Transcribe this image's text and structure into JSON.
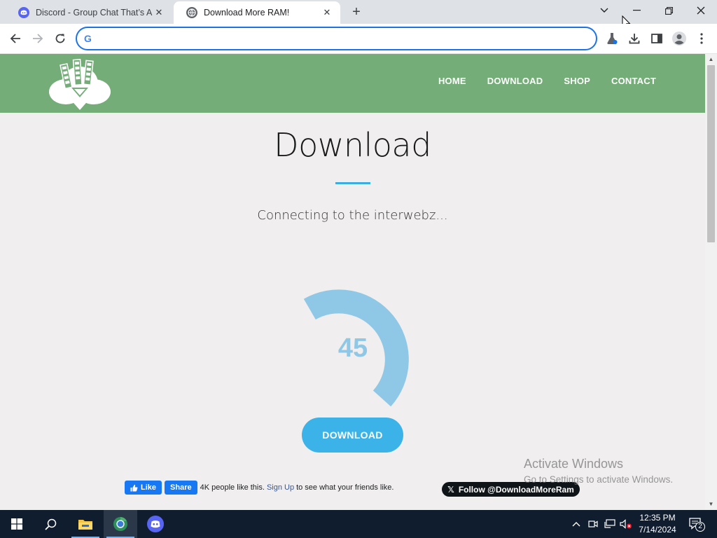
{
  "browser": {
    "tabs": [
      {
        "title": "Discord - Group Chat That’s All Fun & Games",
        "active": false,
        "favicon": "discord-icon"
      },
      {
        "title": "Download More RAM!",
        "active": true,
        "favicon": "globe-icon"
      }
    ],
    "omnibox_value": "",
    "accent_color": "#1a73e8"
  },
  "site": {
    "nav": [
      "HOME",
      "DOWNLOAD",
      "SHOP",
      "CONTACT"
    ],
    "header_color": "#74ad78",
    "page_title": "Download",
    "status_text": "Connecting to the interwebz...",
    "progress": {
      "value": "45",
      "fraction": 0.45,
      "color": "#8fc8e6"
    },
    "download_button": "DOWNLOAD",
    "accent_color": "#3bb3e8",
    "facebook": {
      "like": "Like",
      "share": "Share",
      "count_text": "4K people like this.",
      "signup": "Sign Up",
      "suffix": "to see what your friends like."
    },
    "twitter_follow": "Follow @DownloadMoreRam"
  },
  "watermark": {
    "line1": "Activate Windows",
    "line2": "Go to Settings to activate Windows."
  },
  "taskbar": {
    "time": "12:35 PM",
    "date": "7/14/2024",
    "notifications": "2"
  }
}
